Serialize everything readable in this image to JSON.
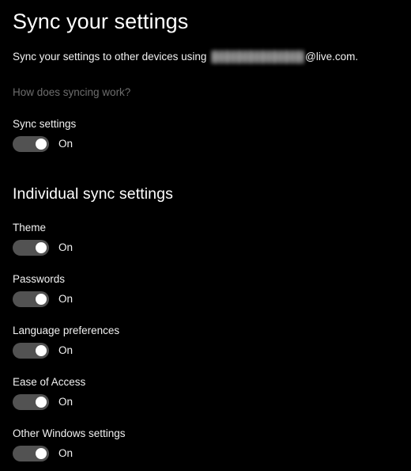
{
  "page": {
    "title": "Sync your settings",
    "background_color": "#000000",
    "text_color": "#f2f2f2"
  },
  "description": {
    "prefix": "Sync your settings to other devices using ",
    "redacted_account": "",
    "suffix": "@live.com."
  },
  "help_link": {
    "label": "How does syncing work?",
    "color": "#6d6d6d"
  },
  "master_setting": {
    "label": "Sync settings",
    "state": "On",
    "toggle_on": true
  },
  "individual": {
    "heading": "Individual sync settings",
    "items": [
      {
        "label": "Theme",
        "state": "On",
        "toggle_on": true
      },
      {
        "label": "Passwords",
        "state": "On",
        "toggle_on": true
      },
      {
        "label": "Language preferences",
        "state": "On",
        "toggle_on": true
      },
      {
        "label": "Ease of Access",
        "state": "On",
        "toggle_on": true
      },
      {
        "label": "Other Windows settings",
        "state": "On",
        "toggle_on": true
      }
    ]
  },
  "colors": {
    "toggle_track_on": "#525252",
    "toggle_knob_on": "#ffffff",
    "accent_text": "#ffffff"
  }
}
